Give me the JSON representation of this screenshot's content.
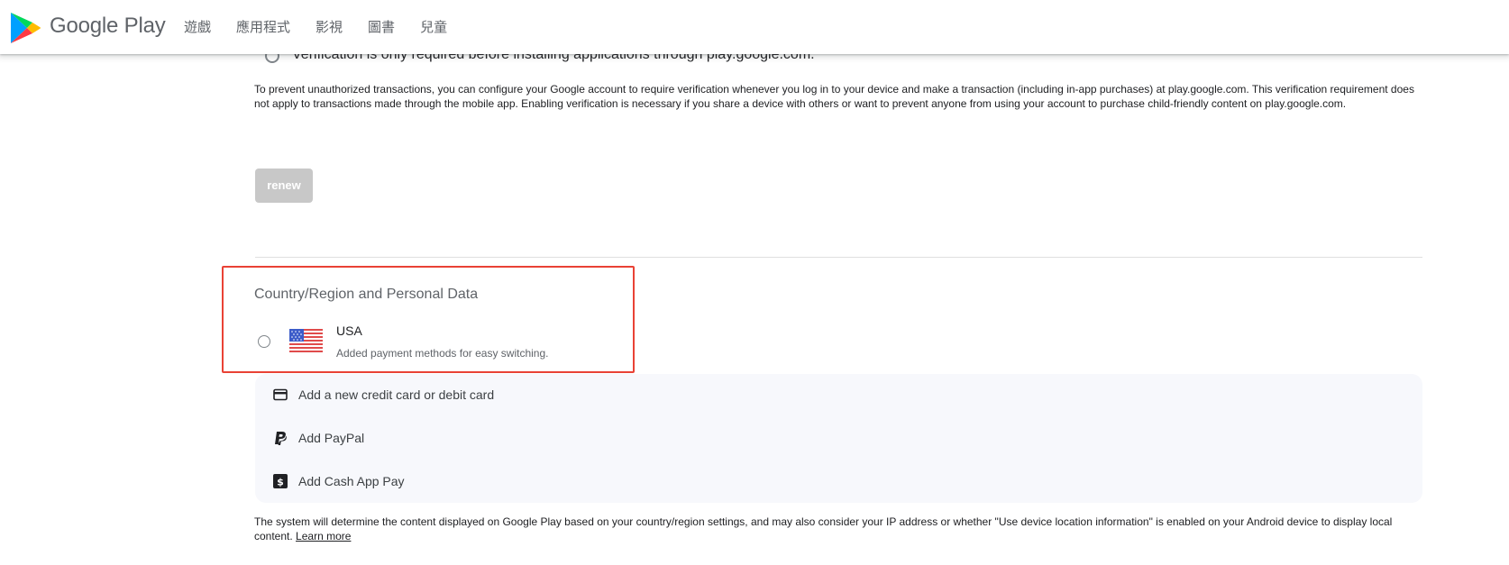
{
  "header": {
    "brand": "Google Play",
    "nav": [
      "遊戲",
      "應用程式",
      "影視",
      "圖書",
      "兒童"
    ]
  },
  "verification": {
    "option_label": "Verification is only required before installing applications through play.google.com.",
    "description": "To prevent unauthorized transactions, you can configure your Google account to require verification whenever you log in to your device and make a transaction (including in-app purchases) at play.google.com. This verification requirement does not apply to transactions made through the mobile app. Enabling verification is necessary if you share a device with others or want to prevent anyone from using your account to purchase child-friendly content on play.google.com.",
    "renew_label": "renew"
  },
  "country": {
    "section_title": "Country/Region and Personal Data",
    "name": "USA",
    "subtitle": "Added payment methods for easy switching."
  },
  "payments": [
    {
      "icon": "credit-card-icon",
      "label": "Add a new credit card or debit card"
    },
    {
      "icon": "paypal-icon",
      "label": "Add PayPal"
    },
    {
      "icon": "cash-app-icon",
      "label": "Add Cash App Pay"
    }
  ],
  "footer": {
    "note": "The system will determine the content displayed on Google Play based on your country/region settings, and may also consider your IP address or whether \"Use device location information\" is enabled on your Android device to display local content.",
    "learn_more": "Learn more"
  },
  "colors": {
    "highlight": "#e94235",
    "panel_bg": "#f7f8fc",
    "disabled_button": "#c8c8c8"
  }
}
